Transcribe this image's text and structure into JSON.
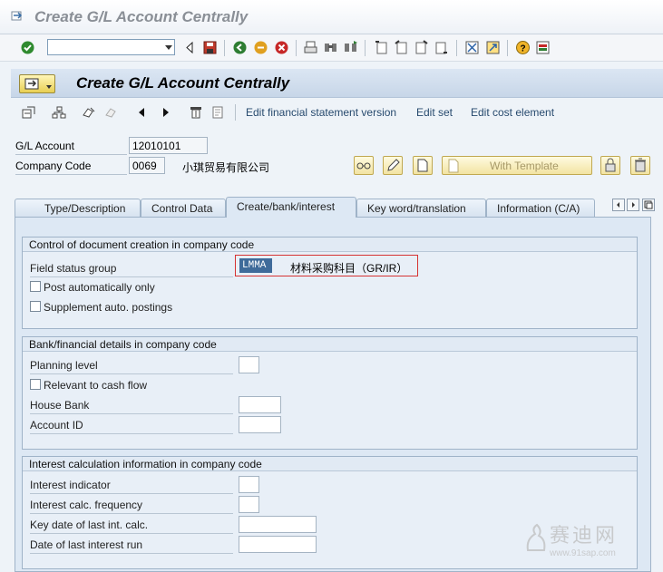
{
  "window": {
    "title": "Create G/L Account Centrally"
  },
  "command_field": {
    "value": "",
    "placeholder": ""
  },
  "standard_toolbar": {
    "icons": [
      "enter-icon",
      "back-icon",
      "save-icon",
      "exit-icon",
      "cancel-icon",
      "print-icon",
      "find-icon",
      "find-next-icon",
      "first-page-icon",
      "previous-page-icon",
      "next-page-icon",
      "last-page-icon",
      "create-session-icon",
      "shortcut-icon",
      "help-icon",
      "layout-menu-icon"
    ]
  },
  "app": {
    "title": "Create G/L Account Centrally",
    "toolbar_links": [
      "Edit financial statement version",
      "Edit set",
      "Edit cost element"
    ]
  },
  "header": {
    "gl_account_label": "G/L Account",
    "gl_account_value": "12010101",
    "company_code_label": "Company Code",
    "company_code_value": "0069",
    "company_name": "小琪贸易有限公司",
    "template_button": "With Template"
  },
  "tabs": [
    {
      "label": "Type/Description",
      "active": false
    },
    {
      "label": "Control Data",
      "active": false
    },
    {
      "label": "Create/bank/interest",
      "active": true
    },
    {
      "label": "Key word/translation",
      "active": false
    },
    {
      "label": "Information (C/A)",
      "active": false
    }
  ],
  "group_control": {
    "title": "Control of document creation in company code",
    "field_status_group_label": "Field status group",
    "field_status_group_value": "LMMA",
    "field_status_group_text": "材料采购科目（GR/IR）",
    "post_automatically": {
      "label": "Post automatically only",
      "checked": false
    },
    "supplement_auto": {
      "label": "Supplement auto. postings",
      "checked": false
    }
  },
  "group_bank": {
    "title": "Bank/financial details in company code",
    "planning_level_label": "Planning level",
    "planning_level_value": "",
    "relevant_cash_flow": {
      "label": "Relevant to cash flow",
      "checked": false
    },
    "house_bank_label": "House Bank",
    "house_bank_value": "",
    "account_id_label": "Account ID",
    "account_id_value": ""
  },
  "group_interest": {
    "title": "Interest calculation information in company code",
    "interest_indicator_label": "Interest indicator",
    "interest_indicator_value": "",
    "interest_frequency_label": "Interest calc. frequency",
    "interest_frequency_value": "",
    "key_date_label": "Key date of last int. calc.",
    "key_date_value": "",
    "last_run_label": "Date of last interest run",
    "last_run_value": ""
  },
  "watermark": {
    "text": "赛迪网",
    "url": "www.91sap.com"
  },
  "colors": {
    "accent": "#3f6b9a",
    "highlight_border": "#d63333",
    "button_yellow": "#f2e3a2"
  }
}
